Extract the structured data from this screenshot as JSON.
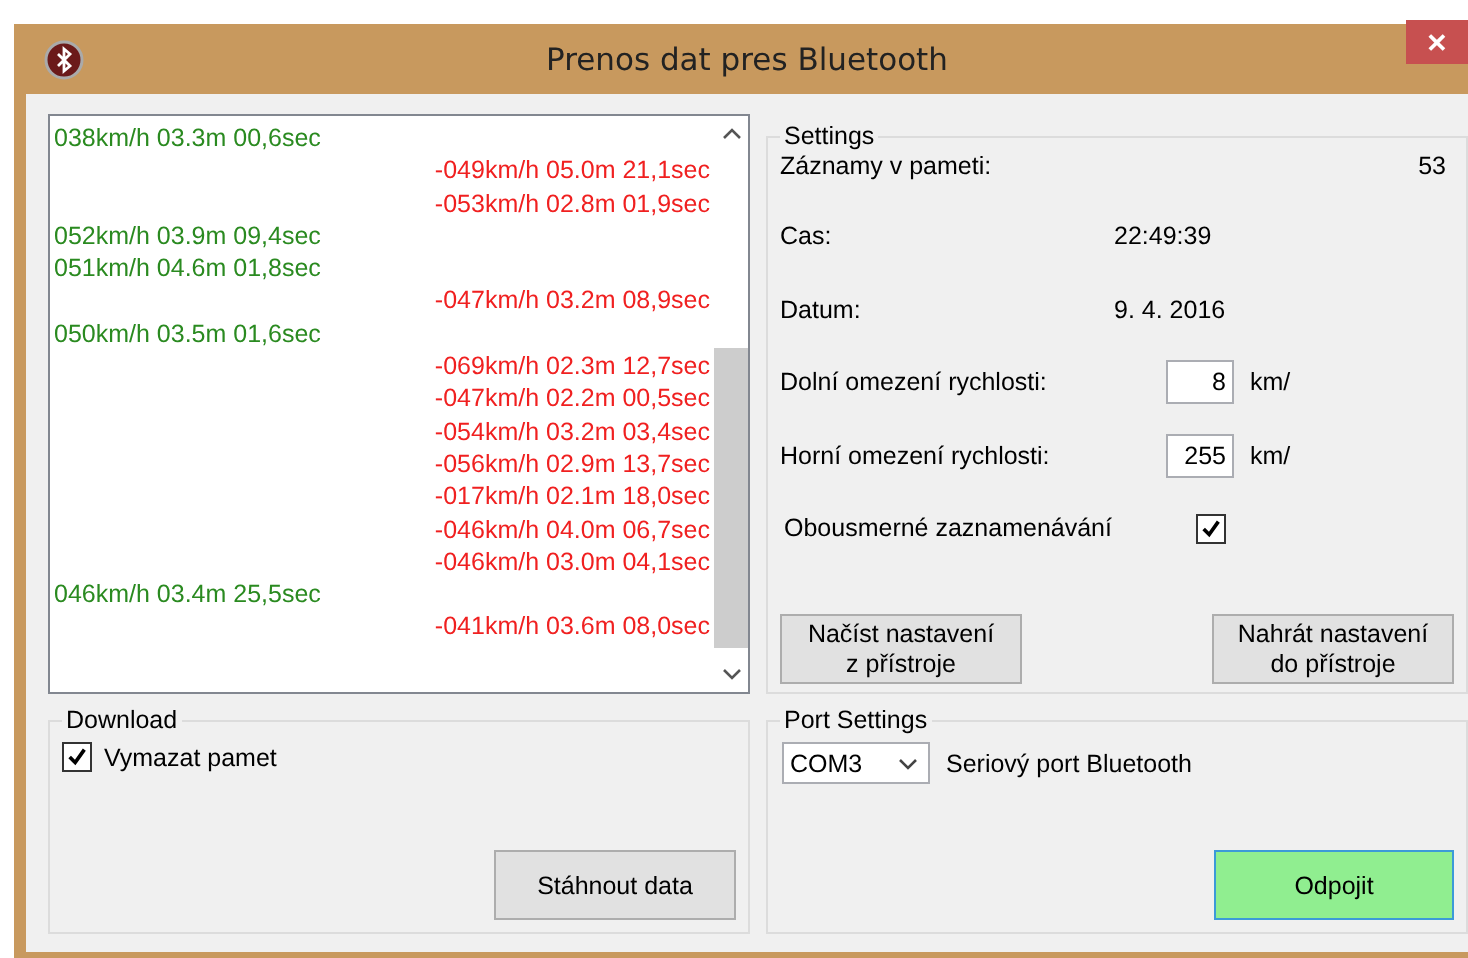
{
  "window": {
    "title": "Prenos dat pres Bluetooth",
    "close": "✕"
  },
  "log": [
    {
      "kind": "in",
      "text": "038km/h 03.3m 00,6sec"
    },
    {
      "kind": "out",
      "text": "-049km/h 05.0m 21,1sec"
    },
    {
      "kind": "out",
      "text": "-053km/h 02.8m 01,9sec"
    },
    {
      "kind": "in",
      "text": "052km/h 03.9m 09,4sec"
    },
    {
      "kind": "in",
      "text": "051km/h 04.6m 01,8sec"
    },
    {
      "kind": "out",
      "text": "-047km/h 03.2m 08,9sec"
    },
    {
      "kind": "in",
      "text": "050km/h 03.5m 01,6sec"
    },
    {
      "kind": "out",
      "text": "-069km/h 02.3m 12,7sec"
    },
    {
      "kind": "out",
      "text": "-047km/h 02.2m 00,5sec"
    },
    {
      "kind": "out",
      "text": "-054km/h 03.2m 03,4sec"
    },
    {
      "kind": "out",
      "text": "-056km/h 02.9m 13,7sec"
    },
    {
      "kind": "out",
      "text": "-017km/h 02.1m 18,0sec"
    },
    {
      "kind": "out",
      "text": "-046km/h 04.0m 06,7sec"
    },
    {
      "kind": "out",
      "text": "-046km/h 03.0m 04,1sec"
    },
    {
      "kind": "in",
      "text": "046km/h 03.4m 25,5sec"
    },
    {
      "kind": "out",
      "text": "-041km/h 03.6m 08,0sec"
    }
  ],
  "settings": {
    "title": "Settings",
    "rows": [
      {
        "kind": "info",
        "label": "Záznamy v pameti:",
        "value": "53"
      },
      {
        "kind": "value",
        "label": "Cas:",
        "value": "22:49:39"
      },
      {
        "kind": "value",
        "label": "Datum:",
        "value": "9. 4. 2016"
      },
      {
        "kind": "input",
        "label": "Dolní omezení rychlosti:",
        "value": "8",
        "unit": "km/"
      },
      {
        "kind": "input",
        "label": "Horní omezení rychlosti:",
        "value": "255",
        "unit": "km/"
      },
      {
        "kind": "check",
        "label": "Obousmerné zaznamenávání",
        "checked": true
      }
    ],
    "buttons": [
      "Načíst nastavení\nz přístroje",
      "Nahrát nastavení\ndo přístroje"
    ]
  },
  "download": {
    "title": "Download",
    "checkbox": {
      "label": "Vymazat pamet",
      "checked": true
    },
    "button": "Stáhnout data"
  },
  "port": {
    "title": "Port Settings",
    "port": "COM3",
    "label": "Seriový port Bluetooth",
    "button": "Odpojit"
  }
}
